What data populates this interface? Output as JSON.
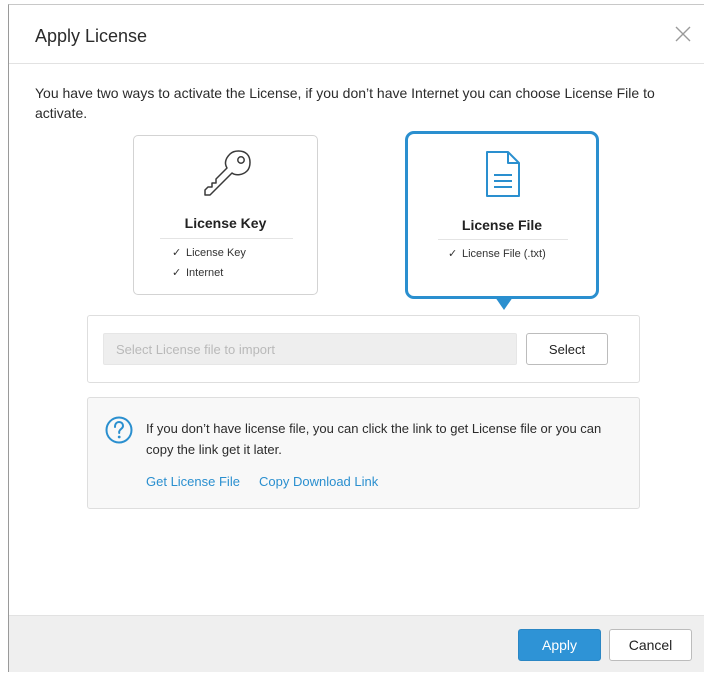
{
  "dialog": {
    "title": "Apply License",
    "close_icon": "close-icon",
    "description": "You have two ways to activate the License, if you don’t have Internet you can choose License File to activate."
  },
  "options": [
    {
      "title": "License Key",
      "icon": "key-icon",
      "features": [
        "License Key",
        "Internet"
      ],
      "selected": false
    },
    {
      "title": "License File",
      "icon": "document-icon",
      "features": [
        "License File (.txt)"
      ],
      "selected": true
    }
  ],
  "import": {
    "placeholder": "Select License file to import",
    "value": "",
    "select_label": "Select"
  },
  "info": {
    "icon": "help-icon",
    "text": "If you don’t have license file, you can click the link to get License file or you can copy the link get it later.",
    "link_get": "Get License File",
    "link_copy": "Copy Download Link"
  },
  "footer": {
    "apply_label": "Apply",
    "cancel_label": "Cancel"
  },
  "colors": {
    "accent": "#2a8fcf",
    "primary_button": "#2e93d6",
    "footer_bg": "#efefef",
    "info_bg": "#f8f8f8"
  }
}
